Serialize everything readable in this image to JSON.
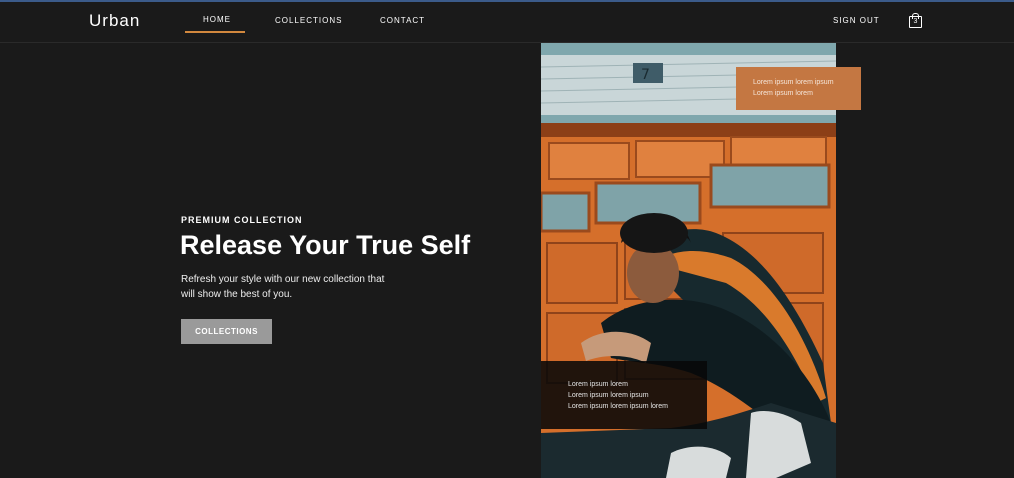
{
  "nav": {
    "logo": "Urban",
    "items": [
      {
        "label": "HOME",
        "active": true
      },
      {
        "label": "COLLECTIONS"
      },
      {
        "label": "CONTACT"
      }
    ],
    "sign_out": "SIGN OUT",
    "cart": {
      "icon": "shopping-bag-icon",
      "count": "3"
    },
    "accent_color": "#d2883e"
  },
  "hero": {
    "eyebrow": "PREMIUM COLLECTION",
    "headline": "Release Your True Self",
    "subtext_lines": [
      "Refresh your style with our new collection that",
      "will show the best of you."
    ],
    "cta_label": "COLLECTIONS",
    "image": "photo-man-crouching-orange-door",
    "overlay_top_lines": [
      "Lorem ipsum lorem ipsum",
      "Lorem ipsum lorem"
    ],
    "overlay_bottom_lines": [
      "Lorem ipsum lorem",
      "Lorem ipsum lorem ipsum",
      "Lorem ipsum lorem ipsum lorem"
    ]
  },
  "colors": {
    "background": "#1a1a1a",
    "overlay_orange": "#c47742",
    "button_gray": "#9a9a9a"
  }
}
